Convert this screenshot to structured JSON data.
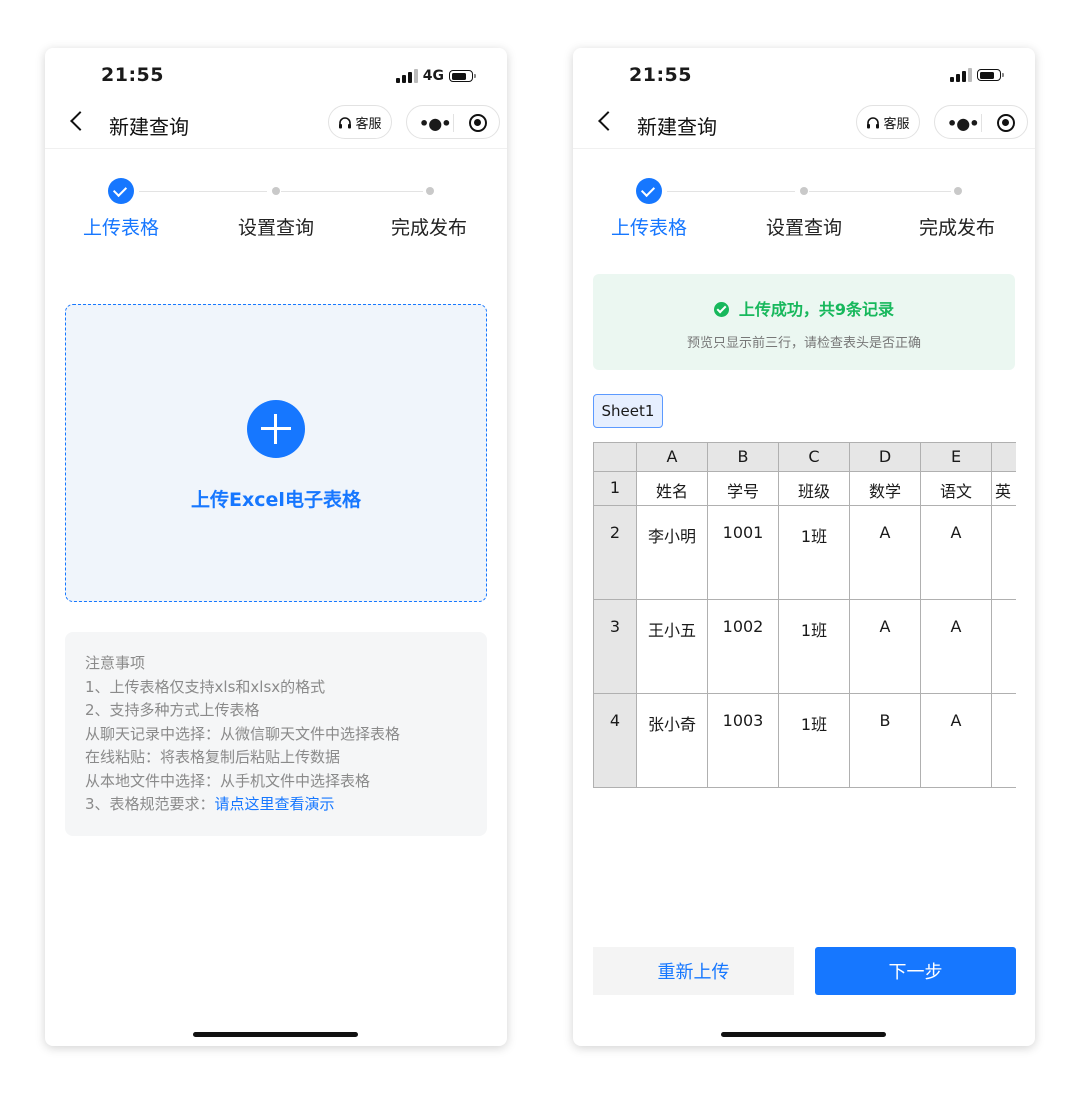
{
  "phone1": {
    "status": {
      "time": "21:55",
      "network": "4G"
    },
    "nav": {
      "title": "新建查询",
      "service_label": "客服"
    },
    "steps": [
      "上传表格",
      "设置查询",
      "完成发布"
    ],
    "upload": {
      "label": "上传Excel电子表格"
    },
    "notes": {
      "title": "注意事项",
      "lines": [
        "1、上传表格仅支持xls和xlsx的格式",
        "2、支持多种方式上传表格",
        "从聊天记录中选择：从微信聊天文件中选择表格",
        "在线粘贴：将表格复制后粘贴上传数据",
        "从本地文件中选择：从手机文件中选择表格"
      ],
      "last_prefix": "3、表格规范要求：",
      "last_link": "请点这里查看演示"
    }
  },
  "phone2": {
    "status": {
      "time": "21:55"
    },
    "nav": {
      "title": "新建查询",
      "service_label": "客服"
    },
    "steps": [
      "上传表格",
      "设置查询",
      "完成发布"
    ],
    "success": {
      "title": "上传成功，共9条记录",
      "subtitle": "预览只显示前三行，请检查表头是否正确"
    },
    "sheet_tab": "Sheet1",
    "table": {
      "col_letters": [
        "A",
        "B",
        "C",
        "D",
        "E",
        ""
      ],
      "row_numbers": [
        "1",
        "2",
        "3",
        "4"
      ],
      "rows": [
        [
          "姓名",
          "学号",
          "班级",
          "数学",
          "语文",
          "英"
        ],
        [
          "李小明",
          "1001",
          "1班",
          "A",
          "A",
          ""
        ],
        [
          "王小五",
          "1002",
          "1班",
          "A",
          "A",
          ""
        ],
        [
          "张小奇",
          "1003",
          "1班",
          "B",
          "A",
          ""
        ]
      ]
    },
    "buttons": {
      "reupload": "重新上传",
      "next": "下一步"
    }
  },
  "colors": {
    "primary": "#1677ff",
    "success": "#17b85c"
  }
}
